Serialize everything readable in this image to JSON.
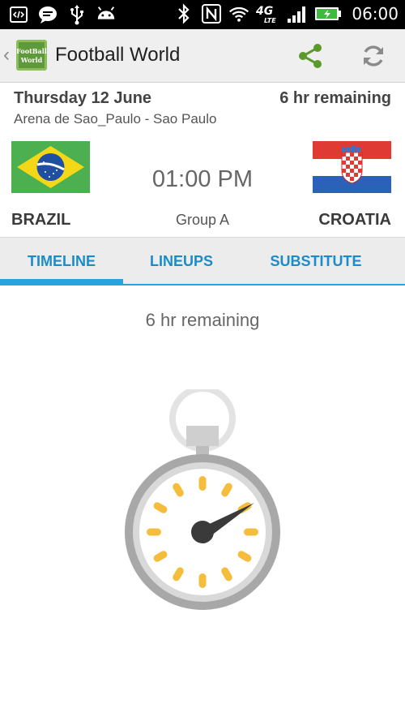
{
  "status_bar": {
    "time": "06:00",
    "network_label": "4G LTE",
    "icons_left": [
      "code-icon",
      "chat-icon",
      "usb-icon",
      "android-icon"
    ],
    "icons_right": [
      "bluetooth-icon",
      "nfc-icon",
      "wifi-icon",
      "lte-icon",
      "signal-icon",
      "battery-icon"
    ]
  },
  "app_bar": {
    "title": "Football World",
    "logo_text_line1": "FootBall",
    "logo_text_line2": "World",
    "actions": [
      "share-icon",
      "refresh-icon"
    ]
  },
  "match": {
    "date": "Thursday 12 June",
    "remaining": "6 hr remaining",
    "venue": "Arena de Sao_Paulo - Sao Paulo",
    "kickoff": "01:00 PM",
    "group": "Group A",
    "home_team": "BRAZIL",
    "away_team": "CROATIA"
  },
  "tabs": {
    "items": [
      "TIMELINE",
      "LINEUPS",
      "SUBSTITUTE"
    ],
    "selected": "TIMELINE"
  },
  "content": {
    "remaining": "6 hr remaining",
    "illustration": "stopwatch-icon"
  },
  "colors": {
    "accent": "#29a3db",
    "tab_text": "#1a8cc8",
    "share_icon": "#5a9a2a",
    "stopwatch_marks": "#f5bd3c",
    "brazil_green": "#4caf50",
    "brazil_yellow": "#f4d817",
    "brazil_blue": "#1e4fa3",
    "croatia_red": "#e03a34",
    "croatia_blue": "#2b61b8"
  }
}
